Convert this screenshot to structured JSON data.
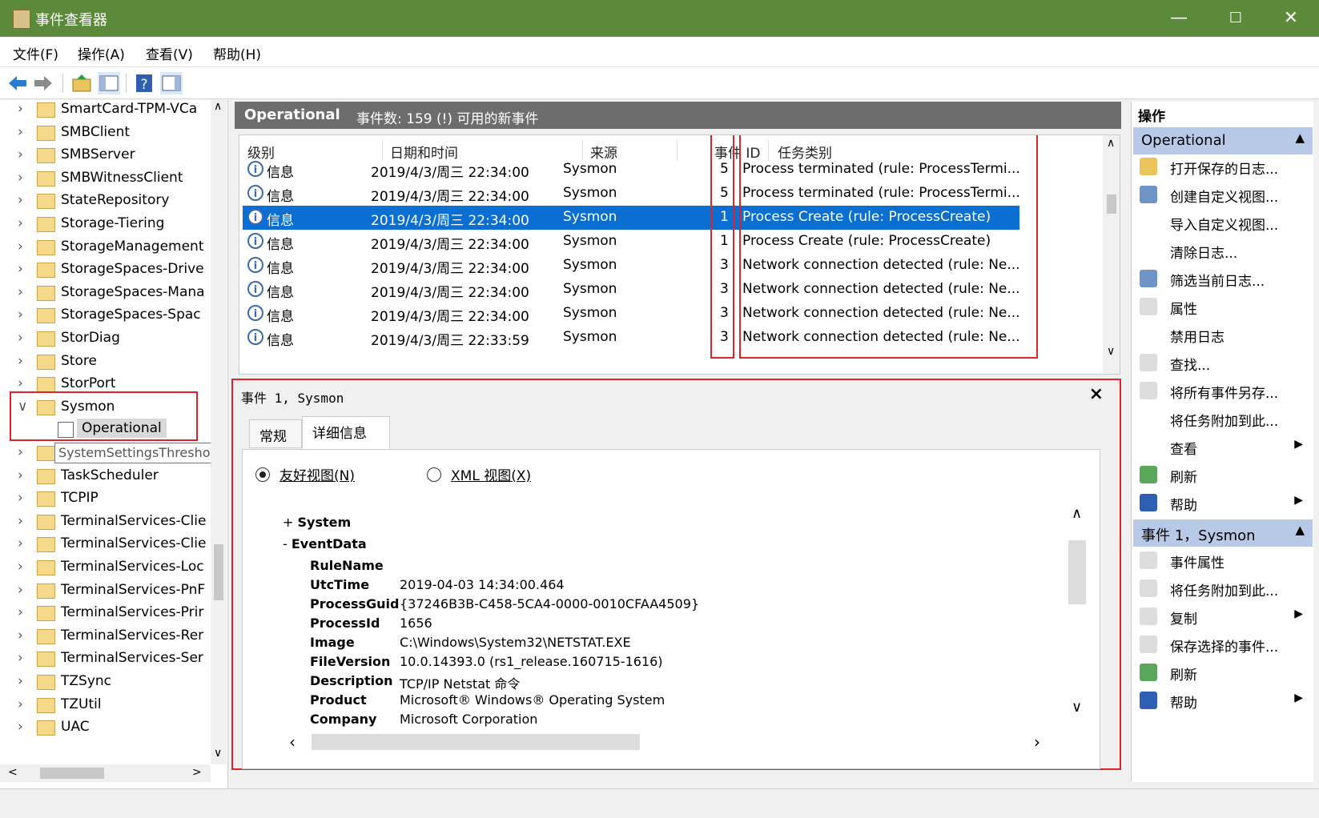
{
  "window": {
    "title": "事件查看器",
    "min": "—",
    "max": "☐",
    "close": "✕"
  },
  "menu": [
    "文件(F)",
    "操作(A)",
    "查看(V)",
    "帮助(H)"
  ],
  "tree": {
    "items": [
      "SmartCard-TPM-VCa",
      "SMBClient",
      "SMBServer",
      "SMBWitnessClient",
      "StateRepository",
      "Storage-Tiering",
      "StorageManagement",
      "StorageSpaces-Drive",
      "StorageSpaces-Mana",
      "StorageSpaces-Spac",
      "StorDiag",
      "Store",
      "StorPort",
      "Sysmon"
    ],
    "selected_child": "Operational",
    "tooltip": "SystemSettingsThreshold",
    "items2": [
      "TaskScheduler",
      "TCPIP",
      "TerminalServices-Clie",
      "TerminalServices-Clie",
      "TerminalServices-Loc",
      "TerminalServices-PnF",
      "TerminalServices-Prir",
      "TerminalServices-Rer",
      "TerminalServices-Ser",
      "TZSync",
      "TZUtil",
      "UAC"
    ]
  },
  "log": {
    "name": "Operational",
    "summary": "事件数: 159 (!) 可用的新事件"
  },
  "grid": {
    "headers": {
      "level": "级别",
      "datetime": "日期和时间",
      "source": "来源",
      "eventid_a": "事件",
      "eventid_b": "ID",
      "task": "任务类别"
    },
    "rows": [
      {
        "level": "信息",
        "datetime": "2019/4/3/周三 22:34:00",
        "source": "Sysmon",
        "id": "5",
        "task": "Process terminated (rule: ProcessTermi..."
      },
      {
        "level": "信息",
        "datetime": "2019/4/3/周三 22:34:00",
        "source": "Sysmon",
        "id": "5",
        "task": "Process terminated (rule: ProcessTermi..."
      },
      {
        "level": "信息",
        "datetime": "2019/4/3/周三 22:34:00",
        "source": "Sysmon",
        "id": "1",
        "task": "Process Create (rule: ProcessCreate)"
      },
      {
        "level": "信息",
        "datetime": "2019/4/3/周三 22:34:00",
        "source": "Sysmon",
        "id": "1",
        "task": "Process Create (rule: ProcessCreate)"
      },
      {
        "level": "信息",
        "datetime": "2019/4/3/周三 22:34:00",
        "source": "Sysmon",
        "id": "3",
        "task": "Network connection detected (rule: Ne..."
      },
      {
        "level": "信息",
        "datetime": "2019/4/3/周三 22:34:00",
        "source": "Sysmon",
        "id": "3",
        "task": "Network connection detected (rule: Ne..."
      },
      {
        "level": "信息",
        "datetime": "2019/4/3/周三 22:34:00",
        "source": "Sysmon",
        "id": "3",
        "task": "Network connection detected (rule: Ne..."
      },
      {
        "level": "信息",
        "datetime": "2019/4/3/周三 22:33:59",
        "source": "Sysmon",
        "id": "3",
        "task": "Network connection detected (rule: Ne..."
      }
    ],
    "selected_index": 2
  },
  "detail": {
    "title": "事件 1, Sysmon",
    "tabs": [
      "常规",
      "详细信息"
    ],
    "radio_friendly": "友好视图(N)",
    "radio_xml": "XML 视图(X)",
    "system_label": "System",
    "eventdata_label": "EventData",
    "fields": [
      {
        "k": "RuleName",
        "v": ""
      },
      {
        "k": "UtcTime",
        "v": "2019-04-03 14:34:00.464"
      },
      {
        "k": "ProcessGuid",
        "v": "{37246B3B-C458-5CA4-0000-0010CFAA4509}"
      },
      {
        "k": "ProcessId",
        "v": "1656"
      },
      {
        "k": "Image",
        "v": "C:\\Windows\\System32\\NETSTAT.EXE"
      },
      {
        "k": "FileVersion",
        "v": "10.0.14393.0 (rs1_release.160715-1616)"
      },
      {
        "k": "Description",
        "v": "TCP/IP Netstat 命令"
      },
      {
        "k": "Product",
        "v": "Microsoft® Windows® Operating System"
      },
      {
        "k": "Company",
        "v": "Microsoft Corporation"
      }
    ]
  },
  "actions": {
    "header": "操作",
    "section1": "Operational",
    "items1": [
      "打开保存的日志...",
      "创建自定义视图...",
      "导入自定义视图...",
      "清除日志...",
      "筛选当前日志...",
      "属性",
      "禁用日志",
      "查找...",
      "将所有事件另存...",
      "将任务附加到此...",
      "查看",
      "刷新",
      "帮助"
    ],
    "section2": "事件 1，Sysmon",
    "items2": [
      "事件属性",
      "将任务附加到此...",
      "复制",
      "保存选择的事件...",
      "刷新",
      "帮助"
    ]
  }
}
